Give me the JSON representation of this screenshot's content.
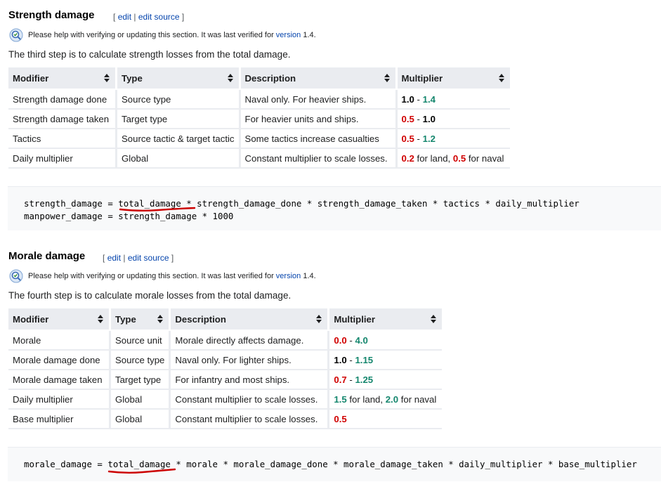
{
  "strength": {
    "title": "Strength damage",
    "edit_bracket_open": "[",
    "edit": "edit",
    "sep": "|",
    "edit_source": "edit source",
    "edit_bracket_close": "]",
    "notice_text": "Please help with verifying or updating this section. It was last verified for",
    "notice_link": "version",
    "notice_version": "1.4.",
    "intro": "The third step is to calculate strength losses from the total damage.",
    "headers": [
      "Modifier",
      "Type",
      "Description",
      "Multiplier"
    ],
    "rows": [
      {
        "modifier": "Strength damage done",
        "type": "Source type",
        "description": "Naval only. For heavier ships.",
        "mult_a": "1.0",
        "mult_sep": " - ",
        "mult_b": "1.4"
      },
      {
        "modifier": "Strength damage taken",
        "type": "Target type",
        "description": "For heavier units and ships.",
        "mult_a": "0.5",
        "mult_sep": " - ",
        "mult_b": "1.0"
      },
      {
        "modifier": "Tactics",
        "type": "Source tactic & target tactic",
        "description": "Some tactics increase casualties",
        "mult_a": "0.5",
        "mult_sep": " - ",
        "mult_b": "1.2"
      },
      {
        "modifier": "Daily multiplier",
        "type": "Global",
        "description": "Constant multiplier to scale losses.",
        "mult_a": "0.2",
        "mult_sep": " for land, ",
        "mult_b": "0.5",
        "mult_c": " for naval"
      }
    ],
    "code_line1": "strength_damage = total_damage * strength_damage_done * strength_damage_taken * tactics * daily_multiplier",
    "code_line2": "manpower_damage = strength_damage * 1000"
  },
  "morale": {
    "title": "Morale damage",
    "edit_bracket_open": "[",
    "edit": "edit",
    "sep": "|",
    "edit_source": "edit source",
    "edit_bracket_close": "]",
    "notice_text": "Please help with verifying or updating this section. It was last verified for",
    "notice_link": "version",
    "notice_version": "1.4.",
    "intro": "The fourth step is to calculate morale losses from the total damage.",
    "headers": [
      "Modifier",
      "Type",
      "Description",
      "Multiplier"
    ],
    "rows": [
      {
        "modifier": "Morale",
        "type": "Source unit",
        "description": "Morale directly affects damage.",
        "mult_a": "0.0",
        "mult_sep": " - ",
        "mult_b": "4.0"
      },
      {
        "modifier": "Morale damage done",
        "type": "Source type",
        "description": "Naval only. For lighter ships.",
        "mult_a": "1.0",
        "mult_sep": " - ",
        "mult_b": "1.15"
      },
      {
        "modifier": "Morale damage taken",
        "type": "Target type",
        "description": "For infantry and most ships.",
        "mult_a": "0.7",
        "mult_sep": " - ",
        "mult_b": "1.25"
      },
      {
        "modifier": "Daily multiplier",
        "type": "Global",
        "description": "Constant multiplier to scale losses.",
        "mult_a": "1.5",
        "mult_sep": " for land, ",
        "mult_b": "2.0",
        "mult_c": " for naval"
      },
      {
        "modifier": "Base multiplier",
        "type": "Global",
        "description": "Constant multiplier to scale losses.",
        "mult_a": "0.5",
        "mult_sep": "",
        "mult_b": ""
      }
    ],
    "code_line1": "morale_damage = total_damage * morale * morale_damage_done * morale_damage_taken * daily_multiplier * base_multiplier"
  },
  "colors": {
    "link": "#0645ad",
    "red": "#d00000",
    "green": "#14866d",
    "annotation": "#cc0000"
  },
  "icons": {
    "notice": "magnifier-check-icon",
    "sort": "sort-arrows-icon"
  }
}
